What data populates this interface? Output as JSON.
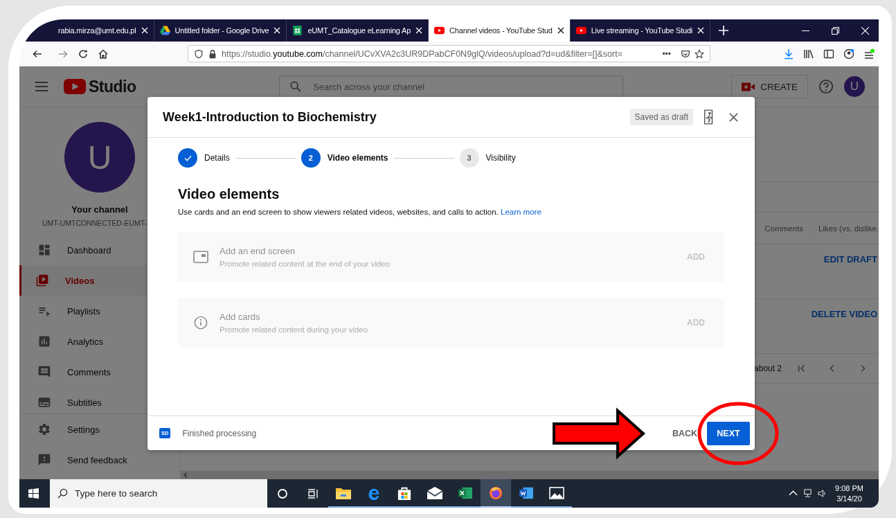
{
  "browser": {
    "tabs": [
      {
        "title": "rabia.mirza@umt.edu.pl",
        "kind": "plain",
        "selected": false
      },
      {
        "title": "Untitled folder - Google Drive",
        "kind": "drive",
        "selected": false
      },
      {
        "title": "eUMT_Catalogue eLearning Ap",
        "kind": "sheets",
        "selected": false
      },
      {
        "title": "Channel videos - YouTube Stud",
        "kind": "youtube",
        "selected": true
      },
      {
        "title": "Live streaming - YouTube Studi",
        "kind": "youtube",
        "selected": false
      }
    ],
    "url": "https://studio.**youtube.com**/channel/UCvXVA2c3UR9DPabCF0N9glQ/videos/upload?d=ud&filter=[]&sort=",
    "page_actions": "•••"
  },
  "studio": {
    "logo": "Studio",
    "search_placeholder": "Search across your channel",
    "create": "CREATE",
    "avatar": "U",
    "channel": {
      "avatar": "U",
      "label": "Your channel",
      "name": "UMT-UMTCONNECTED-EUMT-"
    },
    "nav": [
      {
        "label": "Dashboard",
        "kind": "dashboard",
        "selected": false
      },
      {
        "label": "Videos",
        "kind": "videos",
        "selected": true
      },
      {
        "label": "Playlists",
        "kind": "playlists",
        "selected": false
      },
      {
        "label": "Analytics",
        "kind": "analytics",
        "selected": false
      },
      {
        "label": "Comments",
        "kind": "comments",
        "selected": false
      },
      {
        "label": "Subtitles",
        "kind": "subtitles",
        "selected": false
      }
    ],
    "nav_bottom": [
      {
        "label": "Settings",
        "kind": "settings",
        "selected": false
      },
      {
        "label": "Send feedback",
        "kind": "feedback",
        "selected": false
      }
    ],
    "table": {
      "columns": [
        "Comments",
        "Likes (vs. dislike."
      ],
      "row_actions": [
        "EDIT DRAFT",
        "DELETE VIDEO"
      ],
      "pagination": "about 2"
    }
  },
  "dialog": {
    "title": "Week1-Introduction to Biochemistry",
    "status": "Saved as draft",
    "steps": [
      {
        "label": "Details",
        "completed": true,
        "selected": false
      },
      {
        "label": "Video elements",
        "number": "2",
        "completed": false,
        "selected": true
      },
      {
        "label": "Visibility",
        "number": "3",
        "completed": false,
        "selected": false
      }
    ],
    "heading": "Video elements",
    "description": "Use cards and an end screen to show viewers related videos, websites, and calls to action.",
    "link": "Learn more",
    "cards": [
      {
        "kind": "end_screen",
        "title": "Add an end screen",
        "subtitle": "Promote related content at the end of your video",
        "action": "ADD",
        "disabled": true
      },
      {
        "kind": "info",
        "title": "Add cards",
        "subtitle": "Promote related content during your video",
        "action": "ADD",
        "disabled": true
      }
    ],
    "footer": {
      "badge": "SD",
      "status": "Finished processing",
      "back": "BACK",
      "next": "NEXT"
    }
  },
  "taskbar": {
    "search_placeholder": "Type here to search",
    "apps": [
      {
        "kind": "explorer",
        "selected": false
      },
      {
        "kind": "edge",
        "selected": false
      },
      {
        "kind": "store",
        "selected": false
      },
      {
        "kind": "mail",
        "selected": false
      },
      {
        "kind": "excel",
        "selected": false
      },
      {
        "kind": "firefox",
        "selected": true
      },
      {
        "kind": "word",
        "selected": false
      },
      {
        "kind": "photos",
        "selected": false
      }
    ],
    "time": "9:08 PM",
    "date": "3/14/20"
  }
}
